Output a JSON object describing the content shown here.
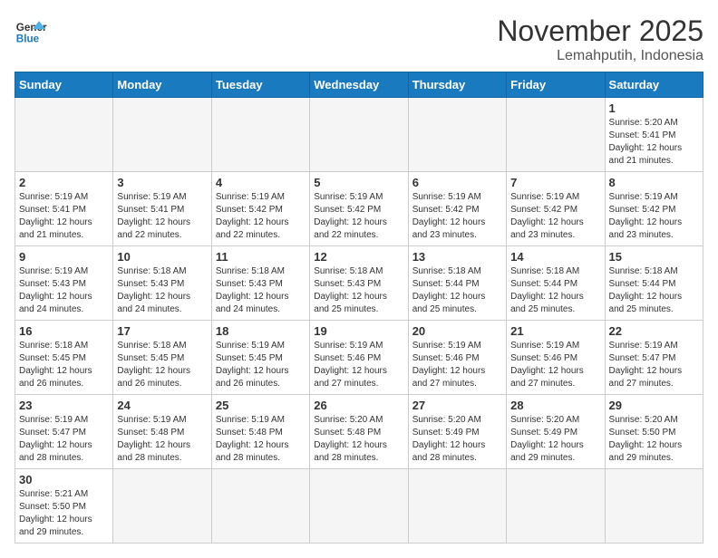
{
  "logo": {
    "text_general": "General",
    "text_blue": "Blue"
  },
  "header": {
    "title": "November 2025",
    "subtitle": "Lemahputih, Indonesia"
  },
  "weekdays": [
    "Sunday",
    "Monday",
    "Tuesday",
    "Wednesday",
    "Thursday",
    "Friday",
    "Saturday"
  ],
  "weeks": [
    [
      {
        "day": null,
        "info": null
      },
      {
        "day": null,
        "info": null
      },
      {
        "day": null,
        "info": null
      },
      {
        "day": null,
        "info": null
      },
      {
        "day": null,
        "info": null
      },
      {
        "day": null,
        "info": null
      },
      {
        "day": "1",
        "info": "Sunrise: 5:20 AM\nSunset: 5:41 PM\nDaylight: 12 hours and 21 minutes."
      }
    ],
    [
      {
        "day": "2",
        "info": "Sunrise: 5:19 AM\nSunset: 5:41 PM\nDaylight: 12 hours and 21 minutes."
      },
      {
        "day": "3",
        "info": "Sunrise: 5:19 AM\nSunset: 5:41 PM\nDaylight: 12 hours and 22 minutes."
      },
      {
        "day": "4",
        "info": "Sunrise: 5:19 AM\nSunset: 5:42 PM\nDaylight: 12 hours and 22 minutes."
      },
      {
        "day": "5",
        "info": "Sunrise: 5:19 AM\nSunset: 5:42 PM\nDaylight: 12 hours and 22 minutes."
      },
      {
        "day": "6",
        "info": "Sunrise: 5:19 AM\nSunset: 5:42 PM\nDaylight: 12 hours and 23 minutes."
      },
      {
        "day": "7",
        "info": "Sunrise: 5:19 AM\nSunset: 5:42 PM\nDaylight: 12 hours and 23 minutes."
      },
      {
        "day": "8",
        "info": "Sunrise: 5:19 AM\nSunset: 5:42 PM\nDaylight: 12 hours and 23 minutes."
      }
    ],
    [
      {
        "day": "9",
        "info": "Sunrise: 5:19 AM\nSunset: 5:43 PM\nDaylight: 12 hours and 24 minutes."
      },
      {
        "day": "10",
        "info": "Sunrise: 5:18 AM\nSunset: 5:43 PM\nDaylight: 12 hours and 24 minutes."
      },
      {
        "day": "11",
        "info": "Sunrise: 5:18 AM\nSunset: 5:43 PM\nDaylight: 12 hours and 24 minutes."
      },
      {
        "day": "12",
        "info": "Sunrise: 5:18 AM\nSunset: 5:43 PM\nDaylight: 12 hours and 25 minutes."
      },
      {
        "day": "13",
        "info": "Sunrise: 5:18 AM\nSunset: 5:44 PM\nDaylight: 12 hours and 25 minutes."
      },
      {
        "day": "14",
        "info": "Sunrise: 5:18 AM\nSunset: 5:44 PM\nDaylight: 12 hours and 25 minutes."
      },
      {
        "day": "15",
        "info": "Sunrise: 5:18 AM\nSunset: 5:44 PM\nDaylight: 12 hours and 25 minutes."
      }
    ],
    [
      {
        "day": "16",
        "info": "Sunrise: 5:18 AM\nSunset: 5:45 PM\nDaylight: 12 hours and 26 minutes."
      },
      {
        "day": "17",
        "info": "Sunrise: 5:18 AM\nSunset: 5:45 PM\nDaylight: 12 hours and 26 minutes."
      },
      {
        "day": "18",
        "info": "Sunrise: 5:19 AM\nSunset: 5:45 PM\nDaylight: 12 hours and 26 minutes."
      },
      {
        "day": "19",
        "info": "Sunrise: 5:19 AM\nSunset: 5:46 PM\nDaylight: 12 hours and 27 minutes."
      },
      {
        "day": "20",
        "info": "Sunrise: 5:19 AM\nSunset: 5:46 PM\nDaylight: 12 hours and 27 minutes."
      },
      {
        "day": "21",
        "info": "Sunrise: 5:19 AM\nSunset: 5:46 PM\nDaylight: 12 hours and 27 minutes."
      },
      {
        "day": "22",
        "info": "Sunrise: 5:19 AM\nSunset: 5:47 PM\nDaylight: 12 hours and 27 minutes."
      }
    ],
    [
      {
        "day": "23",
        "info": "Sunrise: 5:19 AM\nSunset: 5:47 PM\nDaylight: 12 hours and 28 minutes."
      },
      {
        "day": "24",
        "info": "Sunrise: 5:19 AM\nSunset: 5:48 PM\nDaylight: 12 hours and 28 minutes."
      },
      {
        "day": "25",
        "info": "Sunrise: 5:19 AM\nSunset: 5:48 PM\nDaylight: 12 hours and 28 minutes."
      },
      {
        "day": "26",
        "info": "Sunrise: 5:20 AM\nSunset: 5:48 PM\nDaylight: 12 hours and 28 minutes."
      },
      {
        "day": "27",
        "info": "Sunrise: 5:20 AM\nSunset: 5:49 PM\nDaylight: 12 hours and 28 minutes."
      },
      {
        "day": "28",
        "info": "Sunrise: 5:20 AM\nSunset: 5:49 PM\nDaylight: 12 hours and 29 minutes."
      },
      {
        "day": "29",
        "info": "Sunrise: 5:20 AM\nSunset: 5:50 PM\nDaylight: 12 hours and 29 minutes."
      }
    ],
    [
      {
        "day": "30",
        "info": "Sunrise: 5:21 AM\nSunset: 5:50 PM\nDaylight: 12 hours and 29 minutes."
      },
      {
        "day": null,
        "info": null
      },
      {
        "day": null,
        "info": null
      },
      {
        "day": null,
        "info": null
      },
      {
        "day": null,
        "info": null
      },
      {
        "day": null,
        "info": null
      },
      {
        "day": null,
        "info": null
      }
    ]
  ]
}
